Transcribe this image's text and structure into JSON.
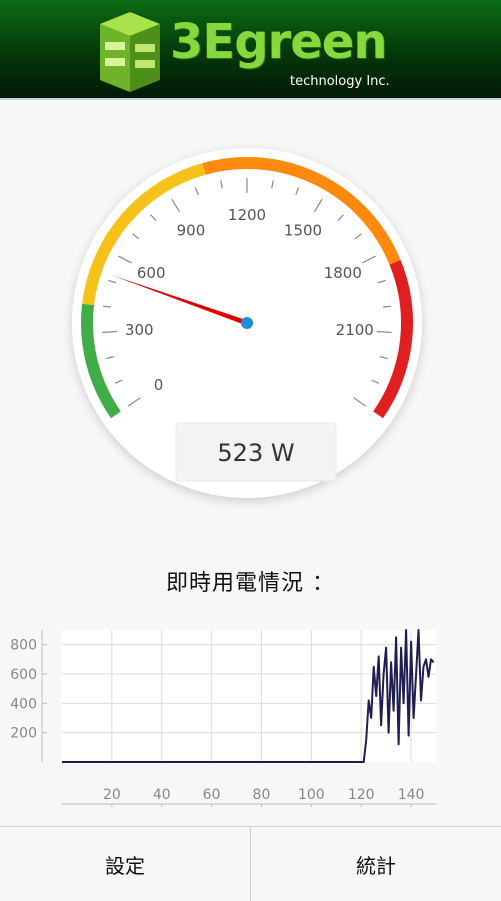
{
  "header": {
    "brand_name": "3Egreen",
    "tagline": "technology Inc.",
    "logo_icon": "3e-cube-logo"
  },
  "gauge": {
    "scale_labels": [
      "0",
      "300",
      "600",
      "900",
      "1200",
      "1500",
      "1800",
      "2100"
    ],
    "min": 0,
    "max": 2400,
    "value": 523,
    "readout": "523 W",
    "band_colors": [
      "#3fae49",
      "#f6c21a",
      "#fd8a0d",
      "#e02020"
    ],
    "needle_color": "#e00000",
    "hub_color": "#1c8fd6"
  },
  "usage_chart": {
    "title": "即時用電情況 ："
  },
  "chart_data": {
    "type": "line",
    "x": [
      0,
      4,
      8,
      12,
      16,
      20,
      24,
      28,
      32,
      36,
      40,
      44,
      48,
      52,
      56,
      60,
      64,
      68,
      72,
      76,
      80,
      84,
      88,
      92,
      96,
      100,
      104,
      108,
      112,
      116,
      120,
      121,
      122,
      123,
      124,
      125,
      126,
      127,
      128,
      129,
      130,
      131,
      132,
      133,
      134,
      135,
      136,
      137,
      138,
      139,
      140,
      141,
      142,
      143,
      144,
      145,
      146,
      147,
      148,
      149
    ],
    "series": [
      {
        "values": [
          0,
          0,
          0,
          0,
          0,
          0,
          0,
          0,
          0,
          0,
          0,
          0,
          0,
          0,
          0,
          0,
          0,
          0,
          0,
          0,
          0,
          0,
          0,
          0,
          0,
          0,
          0,
          0,
          0,
          0,
          0,
          0,
          150,
          420,
          300,
          650,
          450,
          720,
          250,
          600,
          780,
          200,
          680,
          350,
          850,
          120,
          780,
          400,
          900,
          180,
          820,
          300,
          600,
          900,
          420,
          650,
          700,
          580,
          700,
          680
        ]
      }
    ],
    "xticks": [
      "20",
      "40",
      "60",
      "80",
      "100",
      "120",
      "140"
    ],
    "yticks": [
      "200",
      "400",
      "600",
      "800"
    ],
    "xlim": [
      0,
      150
    ],
    "ylim": [
      0,
      900
    ],
    "grid": true,
    "line_color": "#1f1f4f"
  },
  "tabs": [
    {
      "label": "設定"
    },
    {
      "label": "統計"
    }
  ]
}
